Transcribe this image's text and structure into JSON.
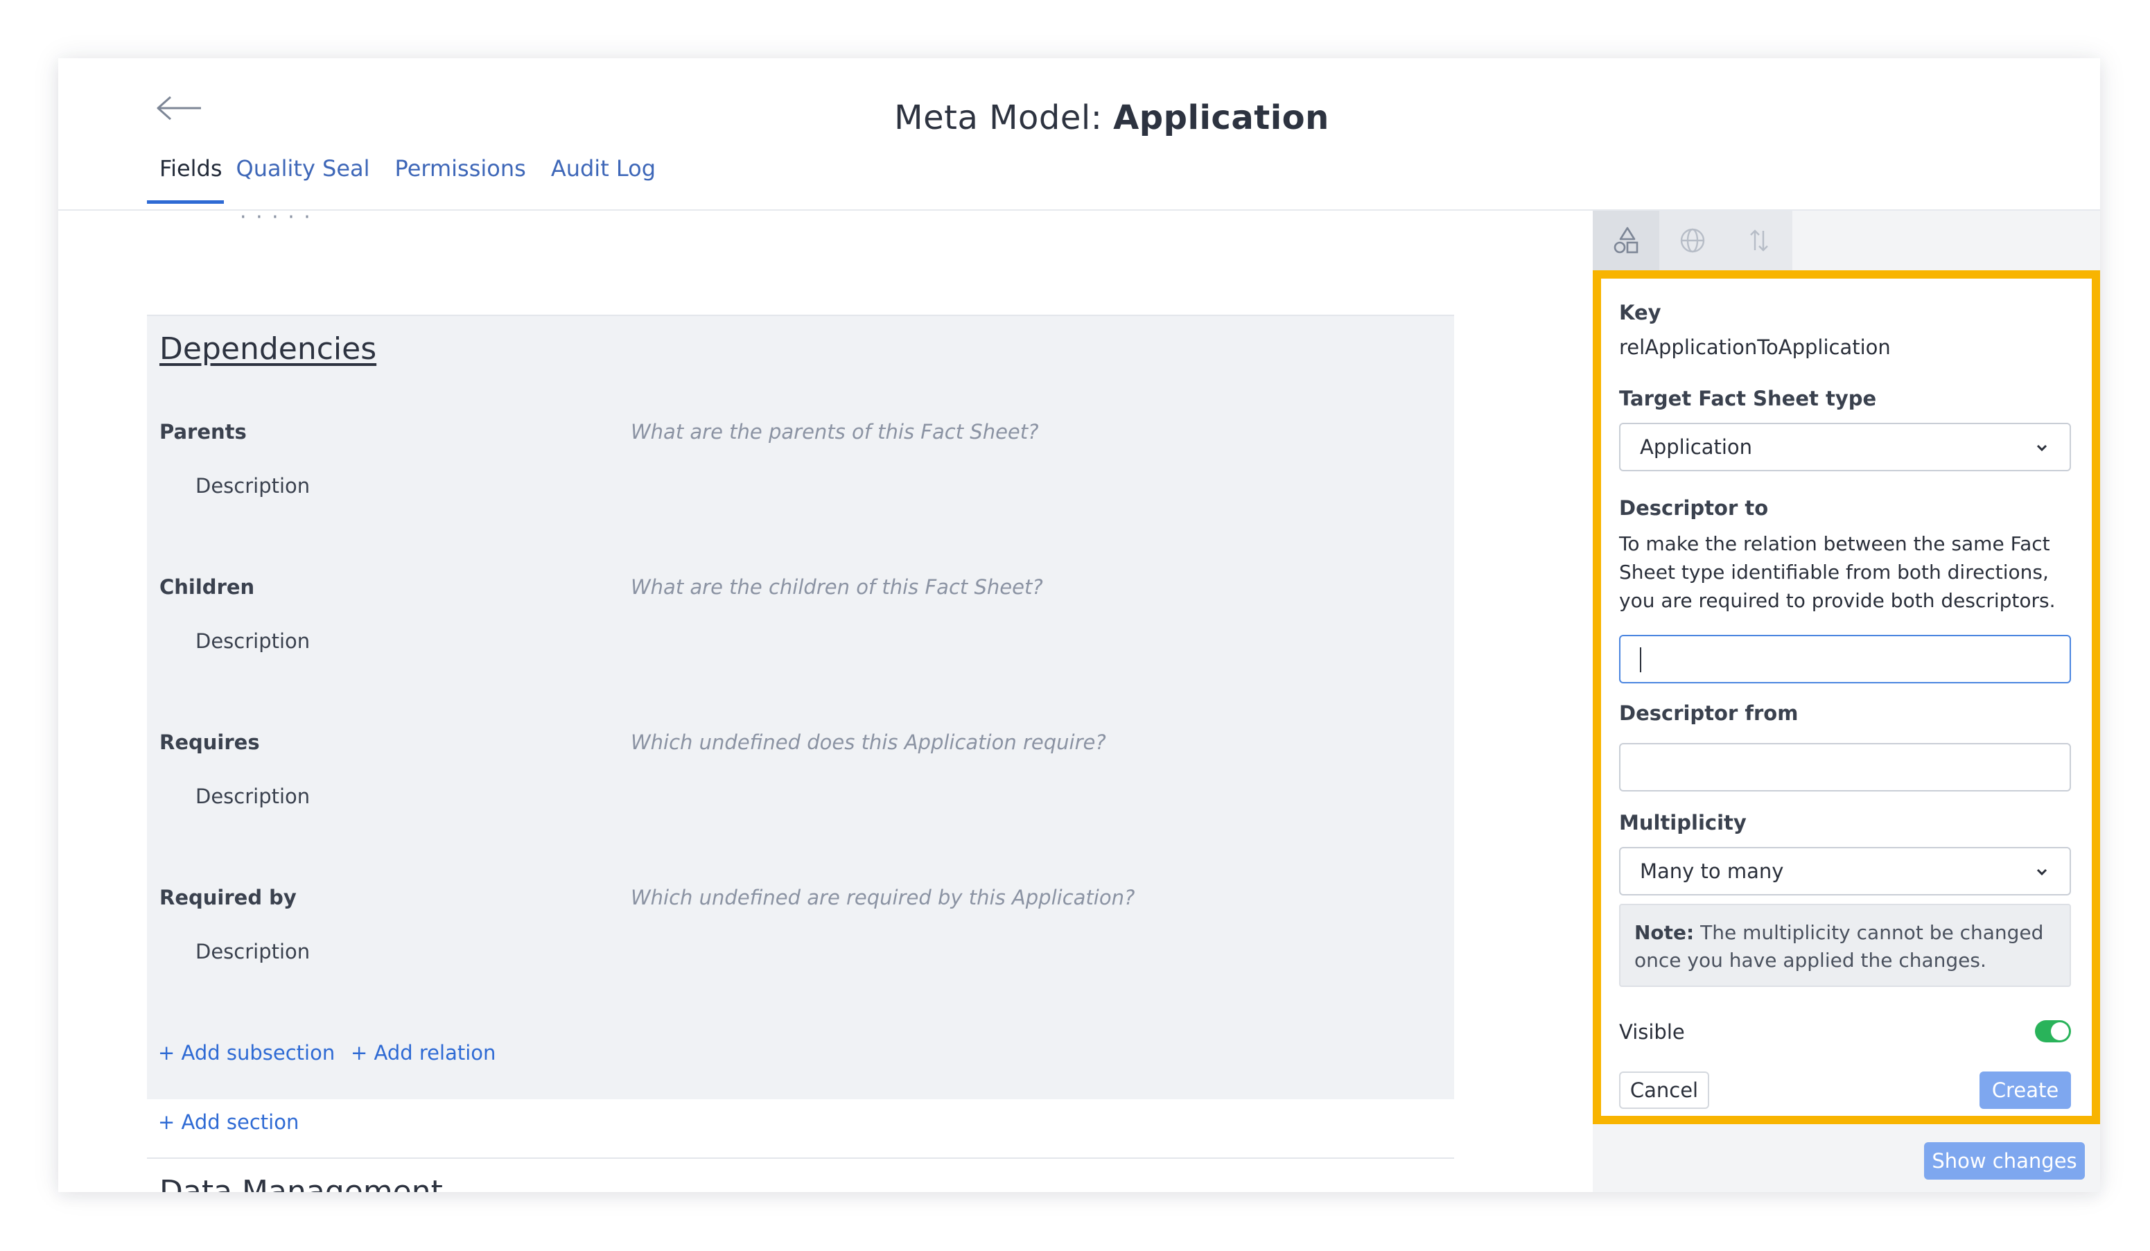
{
  "header": {
    "title_prefix": "Meta Model: ",
    "title_name": "Application",
    "tabs": [
      {
        "label": "Fields",
        "active": true
      },
      {
        "label": "Quality Seal"
      },
      {
        "label": "Permissions"
      },
      {
        "label": "Audit Log"
      }
    ]
  },
  "main": {
    "cut_off_text": "·  ·  ·   ·  ·",
    "section": {
      "title": "Dependencies",
      "relations": [
        {
          "label": "Parents",
          "description_label": "Description",
          "hint": "What are the parents of this Fact Sheet?"
        },
        {
          "label": "Children",
          "description_label": "Description",
          "hint": "What are the children of this Fact Sheet?"
        },
        {
          "label": "Requires",
          "description_label": "Description",
          "hint": "Which undefined does this Application require?"
        },
        {
          "label": "Required by",
          "description_label": "Description",
          "hint": "Which undefined are required by this Application?"
        }
      ],
      "add_subsection": "+ Add subsection",
      "add_relation": "+ Add relation"
    },
    "add_section": "+ Add section",
    "next_section_title": "Data Management"
  },
  "side_panel": {
    "tabs": [
      {
        "icon": "shapes-icon",
        "active": true
      },
      {
        "icon": "globe-icon"
      },
      {
        "icon": "sort-arrows-icon"
      }
    ],
    "key_label": "Key",
    "key_value": "relApplicationToApplication",
    "target_label": "Target Fact Sheet type",
    "target_value": "Application",
    "descriptor_to_label": "Descriptor to",
    "descriptor_to_help": "To make the relation between the same Fact Sheet type identifiable from both directions, you are required to provide both descriptors.",
    "descriptor_to_value": "",
    "descriptor_from_label": "Descriptor from",
    "descriptor_from_value": "",
    "multiplicity_label": "Multiplicity",
    "multiplicity_value": "Many to many",
    "note_bold": "Note:",
    "note_text": " The multiplicity cannot be changed once you have applied the changes.",
    "visible_label": "Visible",
    "visible_on": true,
    "cancel_label": "Cancel",
    "create_label": "Create",
    "show_changes_label": "Show changes"
  },
  "colors": {
    "accent": "#2e6ad4",
    "highlight_border": "#f8b400",
    "toggle_on": "#29b35a",
    "primary_button": "#7ea7ef"
  }
}
